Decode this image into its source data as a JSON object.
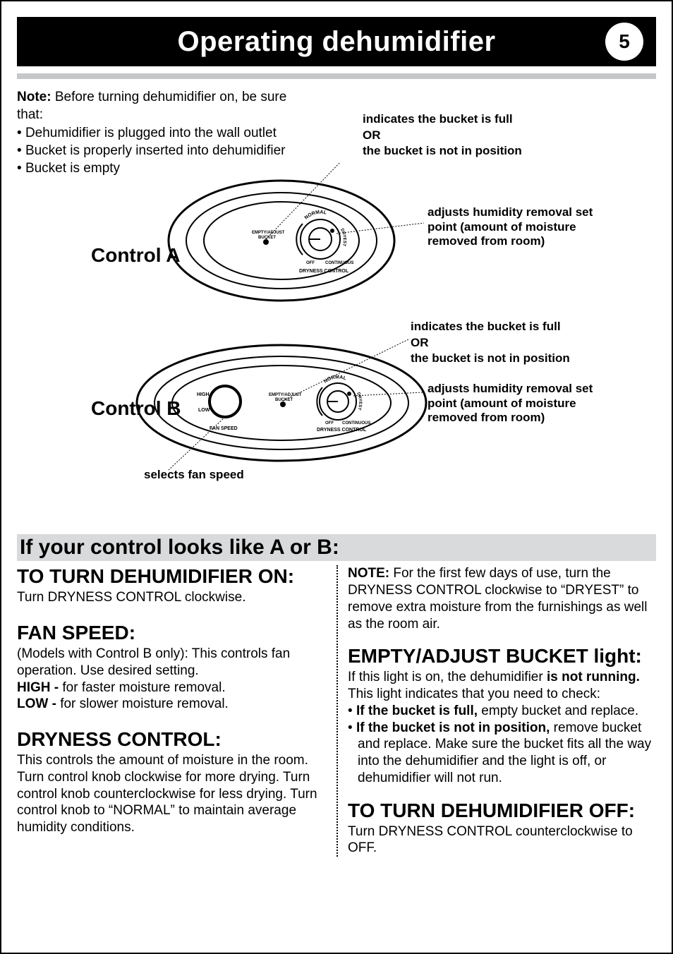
{
  "header": {
    "title": "Operating dehumidifier",
    "page_number": "5"
  },
  "note": {
    "label": "Note:",
    "intro": " Before turning dehumidifier on, be sure that:",
    "items": [
      "Dehumidifier is plugged into the wall outlet",
      "Bucket is properly inserted into dehumidifier",
      "Bucket is empty"
    ]
  },
  "controls": {
    "a_label": "Control A",
    "b_label": "Control B",
    "selects_fan": "selects fan speed",
    "dial": {
      "empty_adjust": "EMPTY/ADJUST",
      "bucket": "BUCKET",
      "normal": "NORMAL",
      "dryest": "DRYEST",
      "off": "OFF",
      "continuous": "CONTINUOUS",
      "dryness_control": "DRYNESS CONTROL",
      "fan_speed": "FAN SPEED",
      "high": "HIGH",
      "low": "LOW"
    },
    "callout_bucket": {
      "line1": "indicates the bucket is full",
      "or": "OR",
      "line2": "the bucket is not in position"
    },
    "callout_adjust": "adjusts humidity removal set point (amount of moisture removed from room)"
  },
  "band_heading": "If your control looks like A or B:",
  "left": {
    "turn_on_title": "TO TURN DEHUMIDIFIER ON:",
    "turn_on_body": "Turn DRYNESS CONTROL clockwise.",
    "fan_title": "FAN SPEED:",
    "fan_body1": "(Models with Control B only):  This controls fan operation. Use desired setting.",
    "fan_high_label": "HIGH -",
    "fan_high": " for faster moisture removal.",
    "fan_low_label": "LOW -",
    "fan_low": " for slower moisture removal.",
    "dry_title": "DRYNESS CONTROL:",
    "dry_body": "This controls the amount of moisture in the room. Turn control knob clockwise for more drying. Turn control knob counterclockwise for less drying. Turn control knob to “NORMAL” to maintain average humidity conditions."
  },
  "right": {
    "note_label": "NOTE:",
    "note_body": " For the first few days of use, turn the DRYNESS CONTROL clockwise to “DRYEST” to remove extra moisture from the furnishings as well as the room air.",
    "empty_title": "EMPTY/ADJUST BUCKET light:",
    "empty_intro_a": "If this light is on, the dehumidifier ",
    "empty_intro_b": "is not running.",
    "empty_intro_c": " This light indicates that you need to check:",
    "b1_label": "If the bucket is full,",
    "b1_body": " empty bucket and replace.",
    "b2_label": "If the bucket is not in position,",
    "b2_body": " remove bucket and replace. Make sure the bucket fits all the way into the dehumidifier and the light is off, or dehumidifier will not run.",
    "off_title": "TO TURN DEHUMIDIFIER OFF:",
    "off_body": "Turn DRYNESS CONTROL counterclockwise to OFF."
  }
}
